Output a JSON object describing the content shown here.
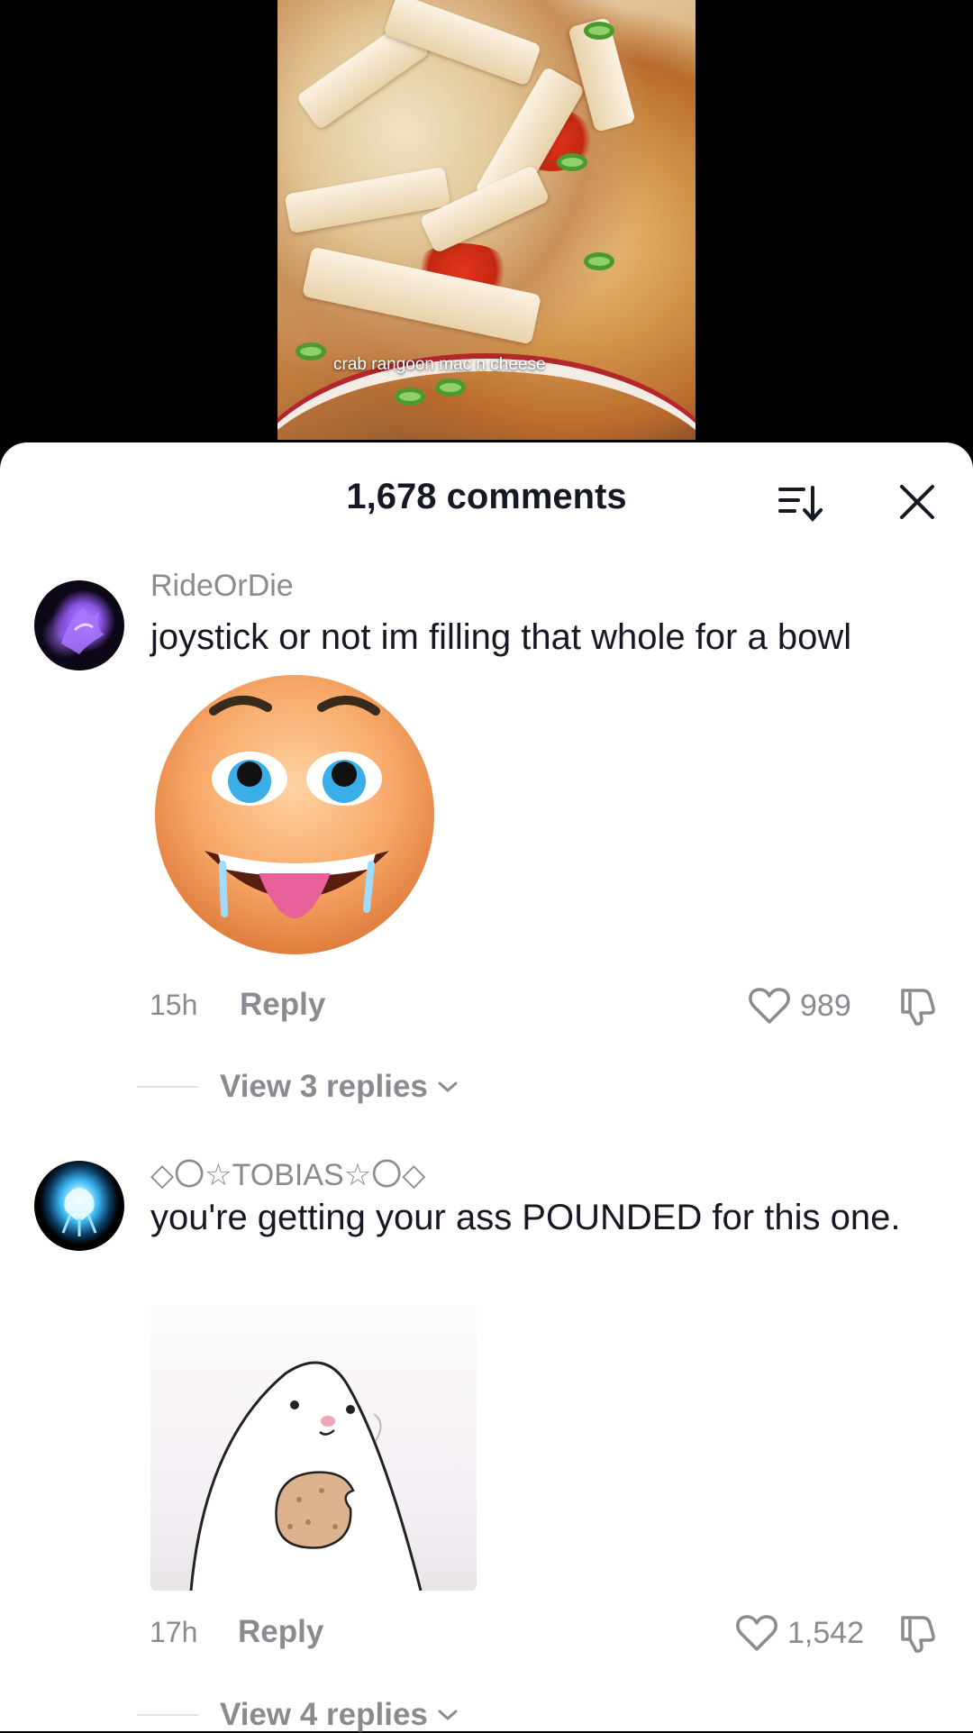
{
  "video": {
    "caption": "crab rangoon mac n cheese"
  },
  "header": {
    "comment_count": "1,678 comments",
    "sort_icon": "sort-descending-icon",
    "close_icon": "close-icon"
  },
  "comments": [
    {
      "username": "RideOrDie",
      "text": "joystick or not im filling that whole for a bowl",
      "sticker": "drooling-emoji-sticker",
      "time": "15h",
      "reply_label": "Reply",
      "likes": "989",
      "view_replies": "View 3 replies"
    },
    {
      "username": "◇〇☆TOBIAS☆〇◇",
      "text": "you're getting your ass POUNDED for this one.",
      "sticker": "cookie-creature-sticker",
      "time": "17h",
      "reply_label": "Reply",
      "likes": "1,542",
      "view_replies": "View 4 replies"
    }
  ],
  "colors": {
    "primary_text": "#161823",
    "secondary_text": "#8a8b91",
    "sheet_background": "#ffffff",
    "video_background": "#000000"
  }
}
